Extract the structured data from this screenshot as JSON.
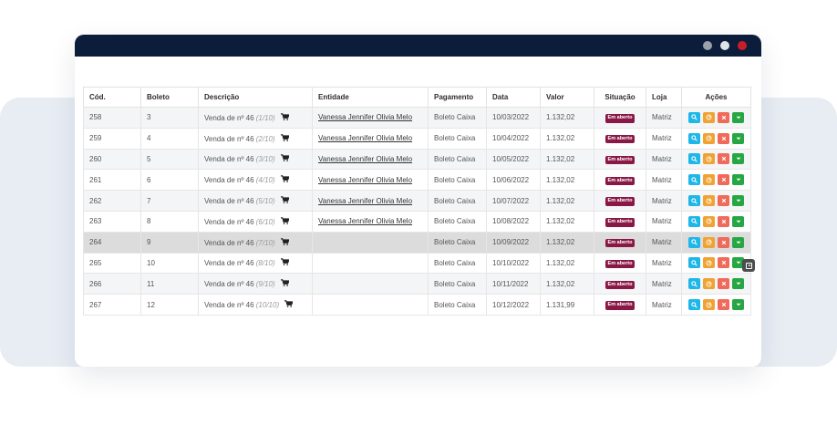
{
  "colors": {
    "titlebar": "#0c1d3b",
    "dot_1": "#9aa1ad",
    "dot_2": "#dfe2e7",
    "dot_3": "#c81e2a",
    "badge": "#8a1846",
    "btn_view": "#1fb6e8",
    "btn_edit": "#f0a232",
    "btn_delete": "#ef6a5a",
    "btn_more": "#27a744"
  },
  "table": {
    "headers": {
      "cod": "Cód.",
      "boleto": "Boleto",
      "descricao": "Descrição",
      "entidade": "Entidade",
      "pagamento": "Pagamento",
      "data": "Data",
      "valor": "Valor",
      "situacao": "Situação",
      "loja": "Loja",
      "acoes": "Ações"
    },
    "rows": [
      {
        "cod": "258",
        "boleto": "3",
        "desc": "Venda de nº 46",
        "parcela": "(1/10)",
        "entidade": "Vanessa Jennifer Olivia Melo",
        "pagamento": "Boleto Caixa",
        "data": "10/03/2022",
        "valor": "1.132,02",
        "situacao": "Em aberto",
        "loja": "Matriz"
      },
      {
        "cod": "259",
        "boleto": "4",
        "desc": "Venda de nº 46",
        "parcela": "(2/10)",
        "entidade": "Vanessa Jennifer Olivia Melo",
        "pagamento": "Boleto Caixa",
        "data": "10/04/2022",
        "valor": "1.132,02",
        "situacao": "Em aberto",
        "loja": "Matriz"
      },
      {
        "cod": "260",
        "boleto": "5",
        "desc": "Venda de nº 46",
        "parcela": "(3/10)",
        "entidade": "Vanessa Jennifer Olivia Melo",
        "pagamento": "Boleto Caixa",
        "data": "10/05/2022",
        "valor": "1.132,02",
        "situacao": "Em aberto",
        "loja": "Matriz"
      },
      {
        "cod": "261",
        "boleto": "6",
        "desc": "Venda de nº 46",
        "parcela": "(4/10)",
        "entidade": "Vanessa Jennifer Olivia Melo",
        "pagamento": "Boleto Caixa",
        "data": "10/06/2022",
        "valor": "1.132,02",
        "situacao": "Em aberto",
        "loja": "Matriz"
      },
      {
        "cod": "262",
        "boleto": "7",
        "desc": "Venda de nº 46",
        "parcela": "(5/10)",
        "entidade": "Vanessa Jennifer Olivia Melo",
        "pagamento": "Boleto Caixa",
        "data": "10/07/2022",
        "valor": "1.132,02",
        "situacao": "Em aberto",
        "loja": "Matriz"
      },
      {
        "cod": "263",
        "boleto": "8",
        "desc": "Venda de nº 46",
        "parcela": "(6/10)",
        "entidade": "Vanessa Jennifer Olivia Melo",
        "pagamento": "Boleto Caixa",
        "data": "10/08/2022",
        "valor": "1.132,02",
        "situacao": "Em aberto",
        "loja": "Matriz"
      },
      {
        "cod": "264",
        "boleto": "9",
        "desc": "Venda de nº 46",
        "parcela": "(7/10)",
        "entidade": "",
        "pagamento": "Boleto Caixa",
        "data": "10/09/2022",
        "valor": "1.132,02",
        "situacao": "Em aberto",
        "loja": "Matriz"
      },
      {
        "cod": "265",
        "boleto": "10",
        "desc": "Venda de nº 46",
        "parcela": "(8/10)",
        "entidade": "",
        "pagamento": "Boleto Caixa",
        "data": "10/10/2022",
        "valor": "1.132,02",
        "situacao": "Em aberto",
        "loja": "Matriz"
      },
      {
        "cod": "266",
        "boleto": "11",
        "desc": "Venda de nº 46",
        "parcela": "(9/10)",
        "entidade": "",
        "pagamento": "Boleto Caixa",
        "data": "10/11/2022",
        "valor": "1.132,02",
        "situacao": "Em aberto",
        "loja": "Matriz"
      },
      {
        "cod": "267",
        "boleto": "12",
        "desc": "Venda de nº 46",
        "parcela": "(10/10)",
        "entidade": "",
        "pagamento": "Boleto Caixa",
        "data": "10/12/2022",
        "valor": "1.131,99",
        "situacao": "Em aberto",
        "loja": "Matriz"
      }
    ],
    "row_icons": {
      "cart": "shopping-cart-icon",
      "view": "search-icon",
      "edit": "edit-icon",
      "delete": "close-icon",
      "more": "caret-down-icon"
    }
  }
}
